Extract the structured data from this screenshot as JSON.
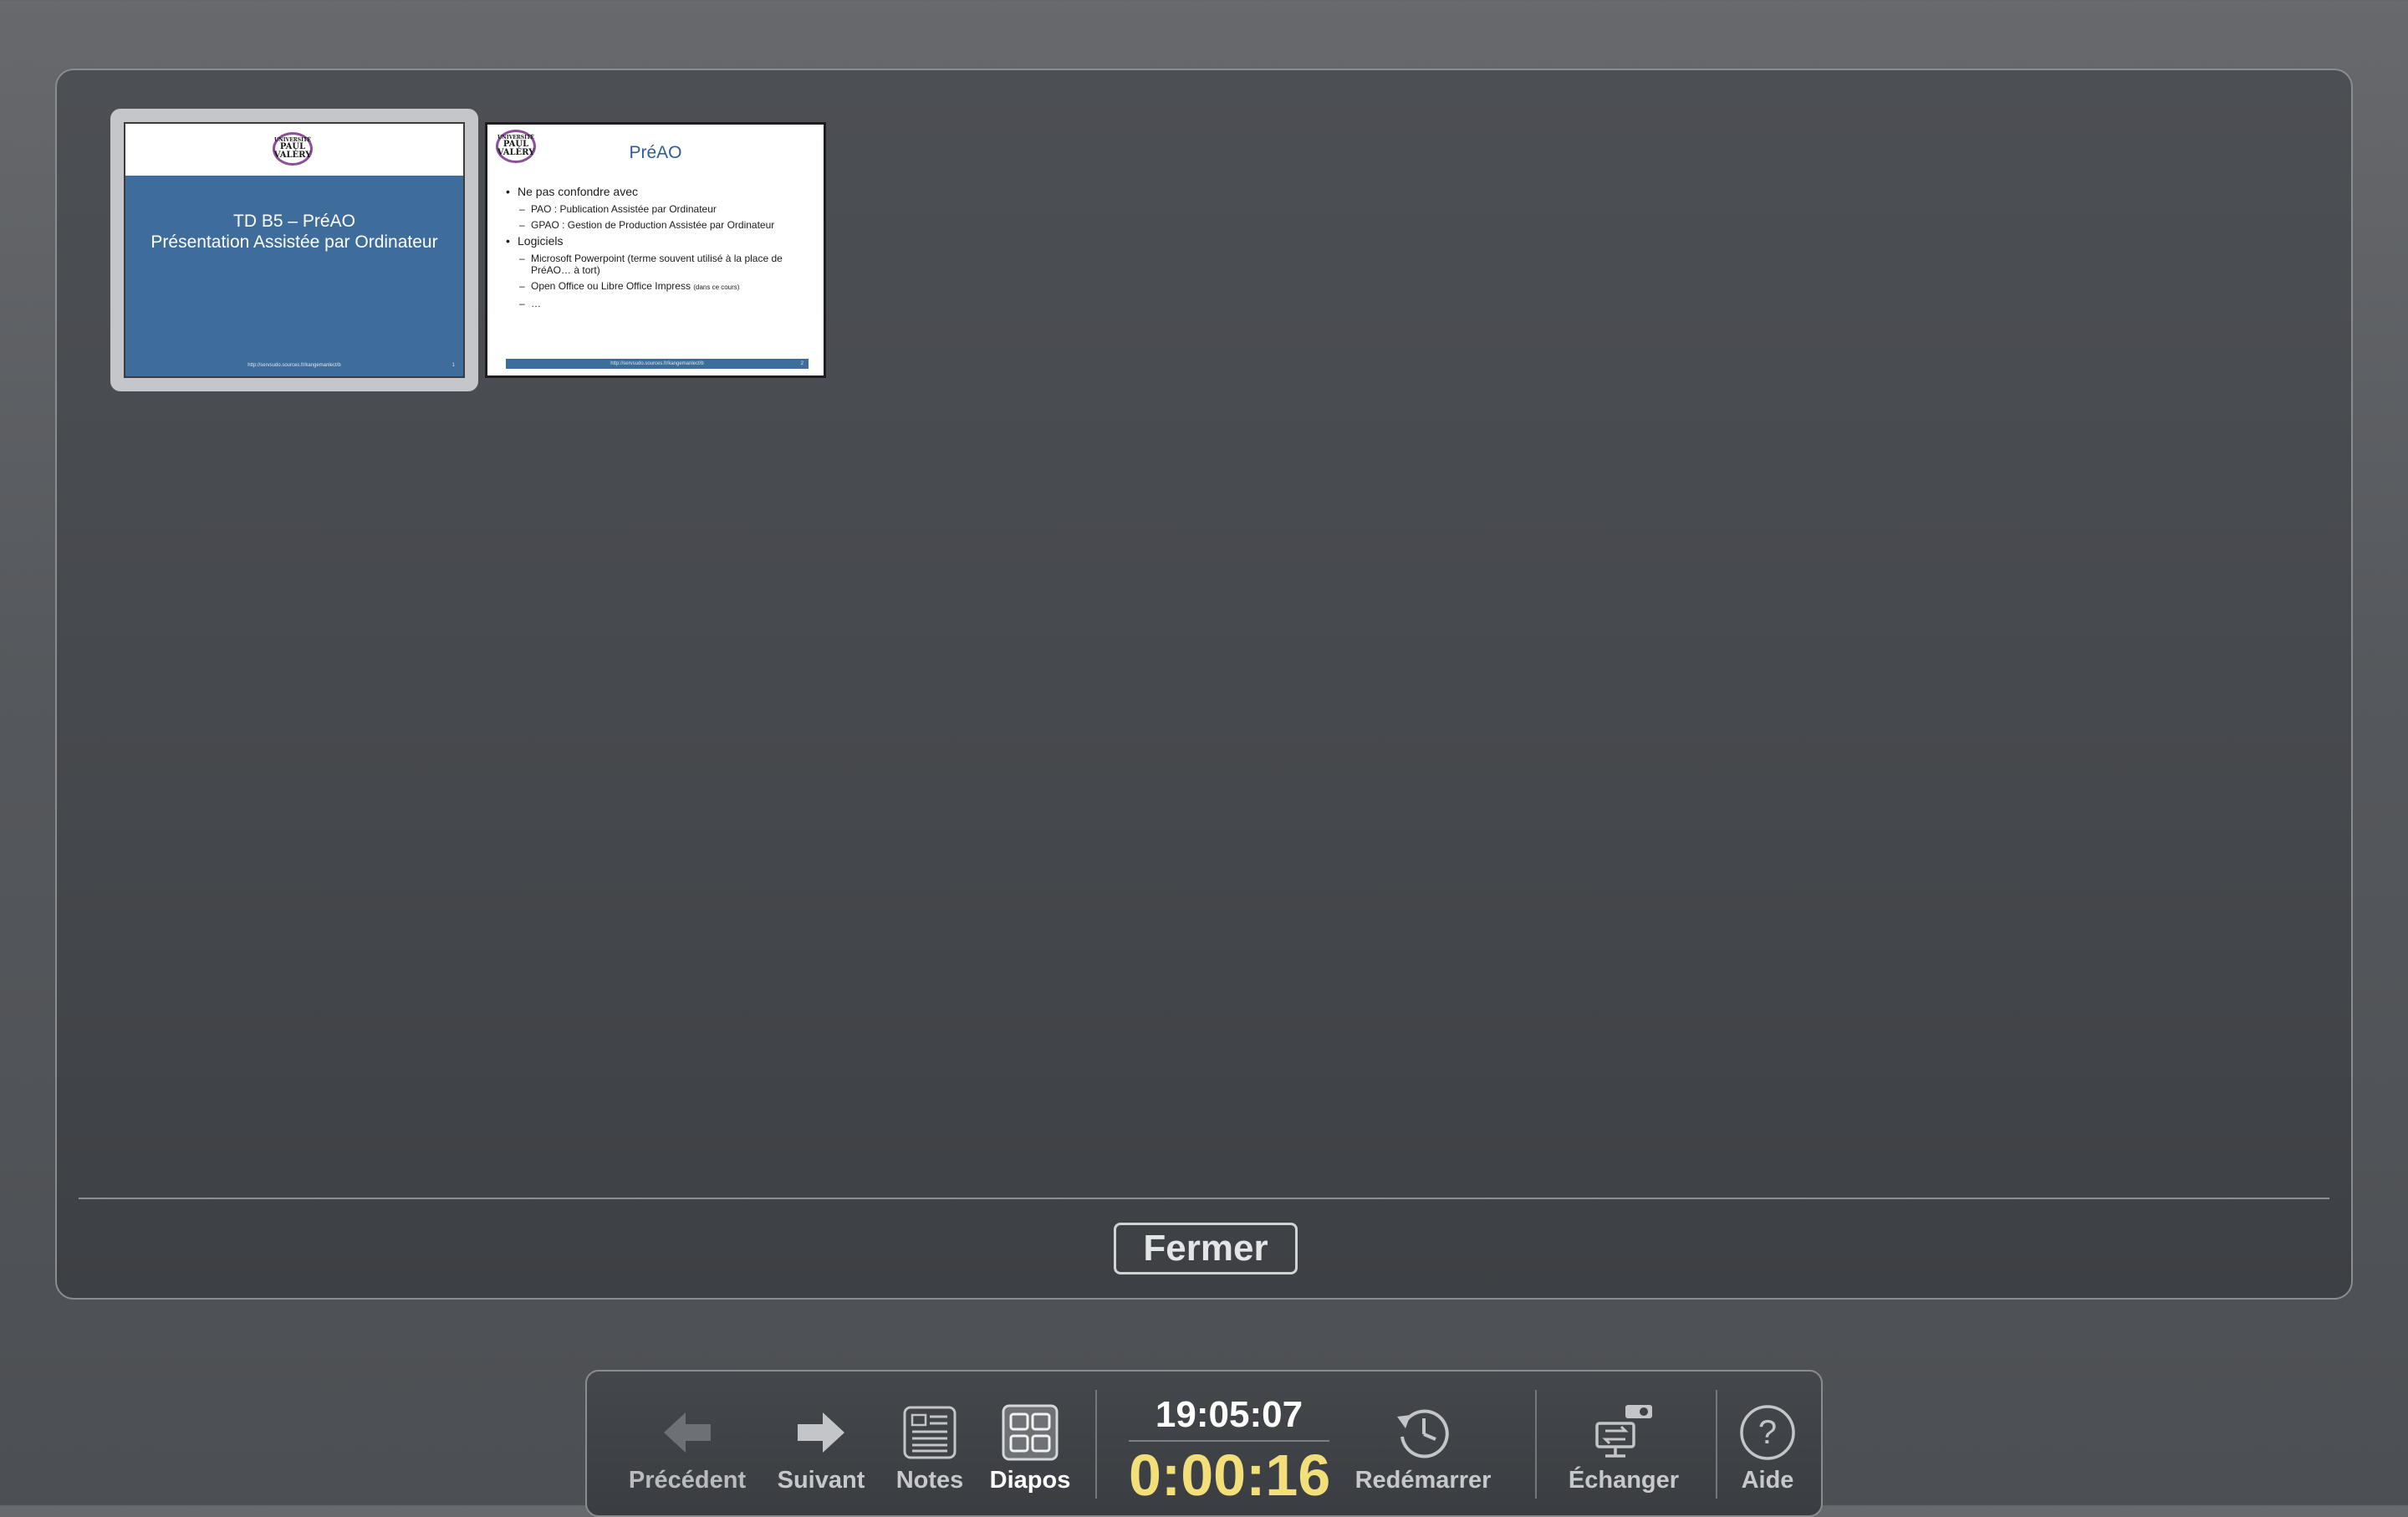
{
  "slide_sorter": {
    "slides": [
      {
        "number": "1",
        "logo_lines": [
          "UNIVERSITÉ",
          "PAUL",
          "VALÉRY"
        ],
        "title_line1": "TD B5 – PréAO",
        "title_line2": "Présentation Assistée par Ordinateur",
        "footer_url": "http://servsudo.sources.fr/kangemanlect/b",
        "selected": true
      },
      {
        "number": "2",
        "logo_lines": [
          "UNIVERSITÉ",
          "PAUL",
          "VALÉRY"
        ],
        "title": "PréAO",
        "bullet1": "Ne pas confondre avec",
        "sub1a": "PAO : Publication Assistée par Ordinateur",
        "sub1b": "GPAO : Gestion de Production Assistée par Ordinateur",
        "bullet2": "Logiciels",
        "sub2a": "Microsoft Powerpoint (terme souvent utilisé à la place de PréAO… à tort)",
        "sub2b_main": "Open Office ou Libre Office Impress",
        "sub2b_small": "(dans ce cours)",
        "sub2c": "…",
        "footer_url": "http://servsudo.sources.fr/kangemanlect/b",
        "selected": false
      }
    ],
    "close_label": "Fermer"
  },
  "toolbar": {
    "previous": {
      "label": "Précédent",
      "icon": "arrow-left-icon",
      "enabled": false
    },
    "next": {
      "label": "Suivant",
      "icon": "arrow-right-icon",
      "enabled": true
    },
    "notes": {
      "label": "Notes",
      "icon": "notes-icon",
      "active": false
    },
    "slides": {
      "label": "Diapos",
      "icon": "grid-icon",
      "active": true
    },
    "clock_time": "19:05:07",
    "elapsed_time": "0:00:16",
    "restart": {
      "label": "Redémarrer",
      "icon": "clock-restart-icon"
    },
    "exchange": {
      "label": "Échanger",
      "icon": "swap-displays-icon"
    },
    "help": {
      "label": "Aide",
      "icon": "help-icon"
    }
  },
  "colors": {
    "slide_blue": "#3e6d9b",
    "title_blue": "#2f5d91",
    "elapsed_yellow": "#f3df7a",
    "logo_purple": "#8d4f9a"
  }
}
